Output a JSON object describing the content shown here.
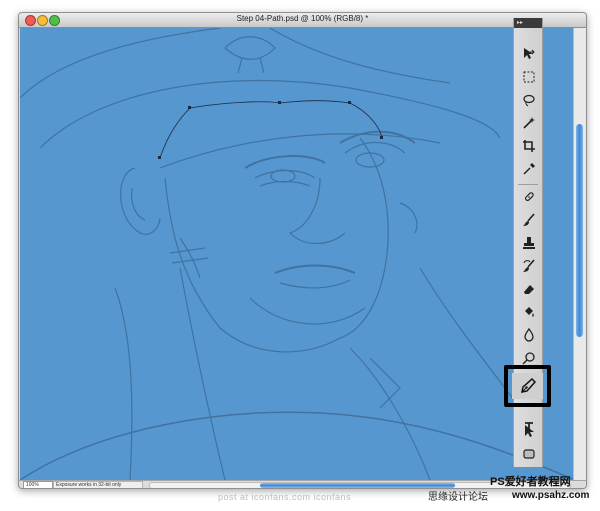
{
  "window": {
    "title": "Step 04-Path.psd @ 100% (RGB/8) *"
  },
  "status": {
    "zoom": "100%",
    "message": "Exposure works in 32-bit only"
  },
  "toolbar": {
    "header_glyph": "▸▸",
    "tools": [
      "move-tool-icon",
      "marquee-tool-icon",
      "lasso-tool-icon",
      "magic-wand-icon",
      "crop-tool-icon",
      "eyedropper-icon",
      "healing-brush-icon",
      "brush-tool-icon",
      "clone-stamp-icon",
      "history-brush-icon",
      "eraser-icon",
      "paint-bucket-icon",
      "blur-tool-icon",
      "dodge-tool-icon",
      "pen-tool-icon",
      "type-tool-icon",
      "path-selection-icon",
      "shape-tool-icon"
    ],
    "highlighted_tool": "pen-tool-icon"
  },
  "colors": {
    "canvas_overlay": "#5697cf",
    "line_art": "#3f6f9c",
    "path_anchor": "#1a2a44",
    "highlight_border": "#000000"
  },
  "footer": {
    "post_credit": "post at iconfans.com iconfans",
    "site_cn": "思缘设计论坛",
    "ps_brand": "PS爱好者教程网",
    "url": "www.psahz.com"
  }
}
